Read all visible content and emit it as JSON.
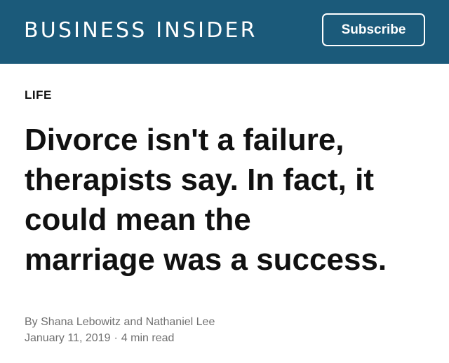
{
  "header": {
    "brand": "BUSINESS INSIDER",
    "subscribe_label": "Subscribe"
  },
  "article": {
    "category": "LIFE",
    "headline_lines": [
      "Divorce isn't a failure,",
      "therapists say. In fact, it",
      "could mean the",
      "marriage was a success."
    ],
    "byline_prefix": "By",
    "authors": [
      "Shana Lebowitz",
      "Nathaniel Lee"
    ],
    "author_joiner": "and",
    "date": "January 11, 2019",
    "separator": "·",
    "read_time": "4 min read"
  },
  "colors": {
    "header_bg": "#1b5a7a",
    "text": "#111111",
    "meta_text": "#707070"
  }
}
